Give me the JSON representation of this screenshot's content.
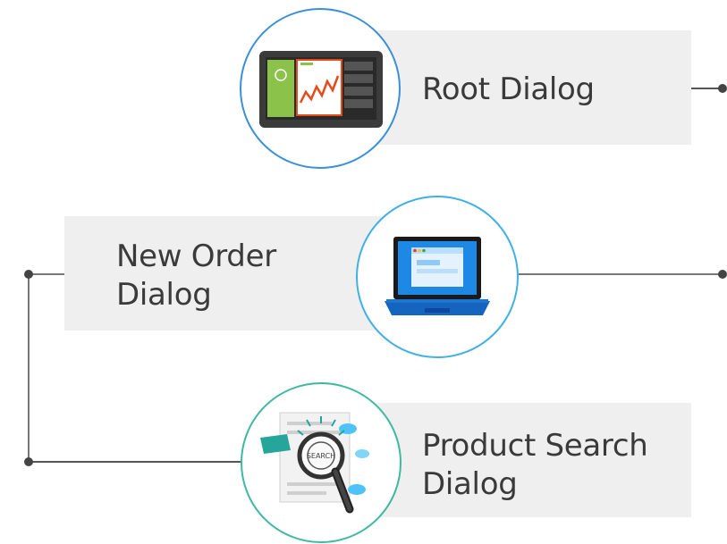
{
  "nodes": {
    "root": {
      "label": "Root Dialog",
      "border_color": "#3a8fd9",
      "icon": "dashboard-monitor-icon"
    },
    "new_order": {
      "label_line1": "New Order",
      "label_line2": "Dialog",
      "border_color": "#3fb0e6",
      "icon": "laptop-icon"
    },
    "product_search": {
      "label_line1": "Product Search",
      "label_line2": "Dialog",
      "border_color": "#3fb8a0",
      "icon": "magnifier-search-icon"
    }
  },
  "colors": {
    "box": "#efefef",
    "connector": "#555555",
    "text": "#3a3a3a"
  }
}
